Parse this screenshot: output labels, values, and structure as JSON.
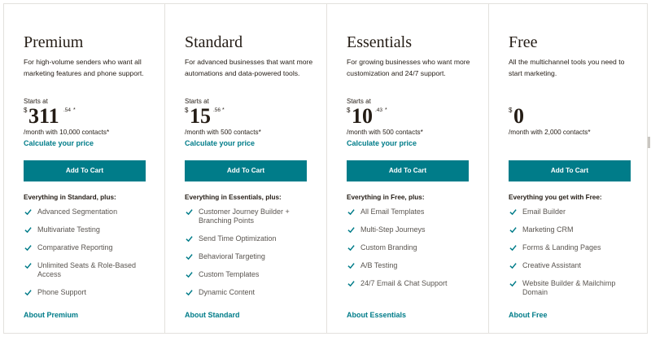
{
  "plans": [
    {
      "name": "Premium",
      "description": "For high-volume senders who want all marketing features and phone support.",
      "starts_at": "Starts at",
      "currency": "$",
      "price": "311",
      "cents": ".54",
      "asterisk": "*",
      "contacts": "/month with 10,000 contacts*",
      "calc_link": "Calculate your price",
      "cart_button": "Add To Cart",
      "features_heading": "Everything in Standard, plus:",
      "features": [
        "Advanced Segmentation",
        "Multivariate Testing",
        "Comparative Reporting",
        "Unlimited Seats & Role-Based Access",
        "Phone Support"
      ],
      "about_link": "About Premium"
    },
    {
      "name": "Standard",
      "description": "For advanced businesses that want more automations and data-powered tools.",
      "starts_at": "Starts at",
      "currency": "$",
      "price": "15",
      "cents": ".56",
      "asterisk": "*",
      "contacts": "/month with 500 contacts*",
      "calc_link": "Calculate your price",
      "cart_button": "Add To Cart",
      "features_heading": "Everything in Essentials, plus:",
      "features": [
        "Customer Journey Builder + Branching Points",
        "Send Time Optimization",
        "Behavioral Targeting",
        "Custom Templates",
        "Dynamic Content"
      ],
      "about_link": "About Standard"
    },
    {
      "name": "Essentials",
      "description": "For growing businesses who want more customization and 24/7 support.",
      "starts_at": "Starts at",
      "currency": "$",
      "price": "10",
      "cents": ".43",
      "asterisk": "*",
      "contacts": "/month with 500 contacts*",
      "calc_link": "Calculate your price",
      "cart_button": "Add To Cart",
      "features_heading": "Everything in Free, plus:",
      "features": [
        "All Email Templates",
        "Multi-Step Journeys",
        "Custom Branding",
        "A/B Testing",
        "24/7 Email & Chat Support"
      ],
      "about_link": "About Essentials"
    },
    {
      "name": "Free",
      "description": "All the multichannel tools you need to start marketing.",
      "starts_at": "",
      "currency": "$",
      "price": "0",
      "cents": "",
      "asterisk": "",
      "contacts": "/month with 2,000 contacts*",
      "calc_link": "",
      "cart_button": "Add To Cart",
      "features_heading": "Everything you get with Free:",
      "features": [
        "Email Builder",
        "Marketing CRM",
        "Forms & Landing Pages",
        "Creative Assistant",
        "Website Builder & Mailchimp Domain"
      ],
      "about_link": "About Free"
    }
  ],
  "colors": {
    "accent": "#007c89",
    "text": "#241c15",
    "muted": "#5a5550",
    "border": "#e3e1dd"
  },
  "icons": {
    "feature_check": "check-icon"
  }
}
